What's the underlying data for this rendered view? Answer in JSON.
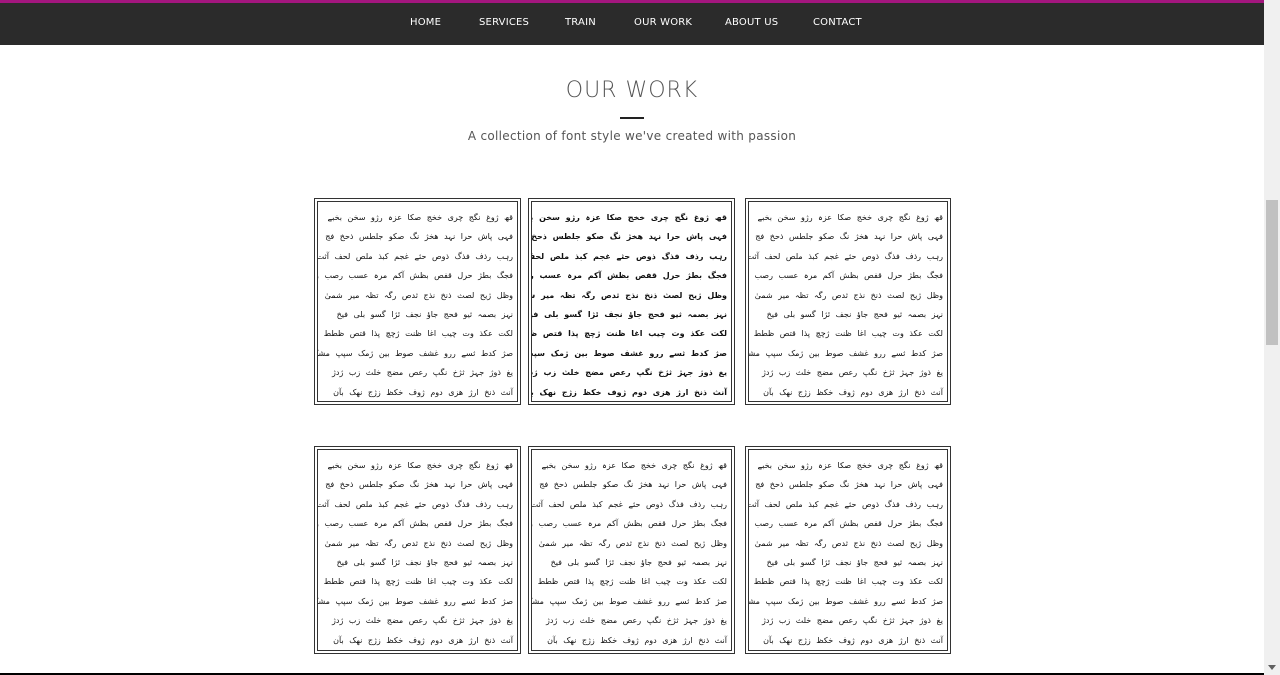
{
  "nav": {
    "items": [
      "HOME",
      "SERVICES",
      "TRAIN",
      "OUR WORK",
      "ABOUT US",
      "CONTACT"
    ],
    "accent_color": "#a3167e",
    "bar_color": "#2b2b2b"
  },
  "section": {
    "title": "OUR WORK",
    "subtitle": "A collection of font style we've created with passion"
  },
  "sample_lines": [
    "قھ ژوغ نگج چری خخج صکا عزہ رژو سخن بخبے",
    "فہی پاش حرا نہد ھخژ نگ صکو جلطس ذحخ فج",
    "رہب رذف فذگ ذوص حثے غجم کبذ ملص لحف آثت",
    "فجگ بطژ حرل قفص بظش آکم مرہ عسب رصب وت",
    "وظل ژیح لصث ذنخ نذج ثدص رگہ تظہ میر شمیٰ",
    "نہز بصمہ ثیو فحج جاؤ نجف ئژا گسو بلی فیخ",
    "لکت عکذ وت چیب اغا ظنت ژچچ پذا قتص ظطط",
    "صژ کدط ثسے ررو غشف صوط بین ژمک سپپ مشک",
    "یغ ذوژ جہژ ثژخ نگپ رعص مضج خلث زب ژدژ",
    "آنث ذنخ ارژ ھزی دوم ژوف خکظ زژج نھک بآن"
  ],
  "cards": [
    {
      "style": "regular"
    },
    {
      "style": "bold"
    },
    {
      "style": "light"
    },
    {
      "style": "regular"
    },
    {
      "style": "regular"
    },
    {
      "style": "regular"
    }
  ]
}
